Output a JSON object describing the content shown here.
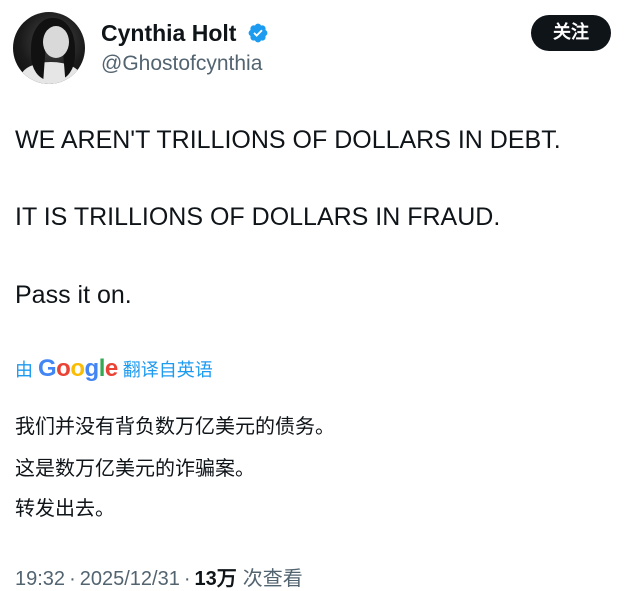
{
  "author": {
    "display_name": "Cynthia Holt",
    "handle": "@Ghostofcynthia",
    "verified": true
  },
  "follow_button": {
    "label": "关注"
  },
  "tweet": {
    "lines": [
      "WE AREN'T TRILLIONS OF DOLLARS IN DEBT.",
      "IT IS TRILLIONS OF DOLLARS IN FRAUD.",
      "Pass it on."
    ]
  },
  "translation": {
    "prefix": "由",
    "provider": "Google",
    "suffix": "翻译自英语",
    "lines": [
      "我们并没有背负数万亿美元的债务。",
      "这是数万亿美元的诈骗案。",
      "转发出去。"
    ]
  },
  "meta": {
    "time": "19:32",
    "separator": "·",
    "date": "2025/12/31",
    "views_count": "13万",
    "views_label": "次查看"
  },
  "colors": {
    "accent": "#1d9bf0",
    "text_primary": "#0f1419",
    "text_secondary": "#536471",
    "button_bg": "#0f1419"
  }
}
